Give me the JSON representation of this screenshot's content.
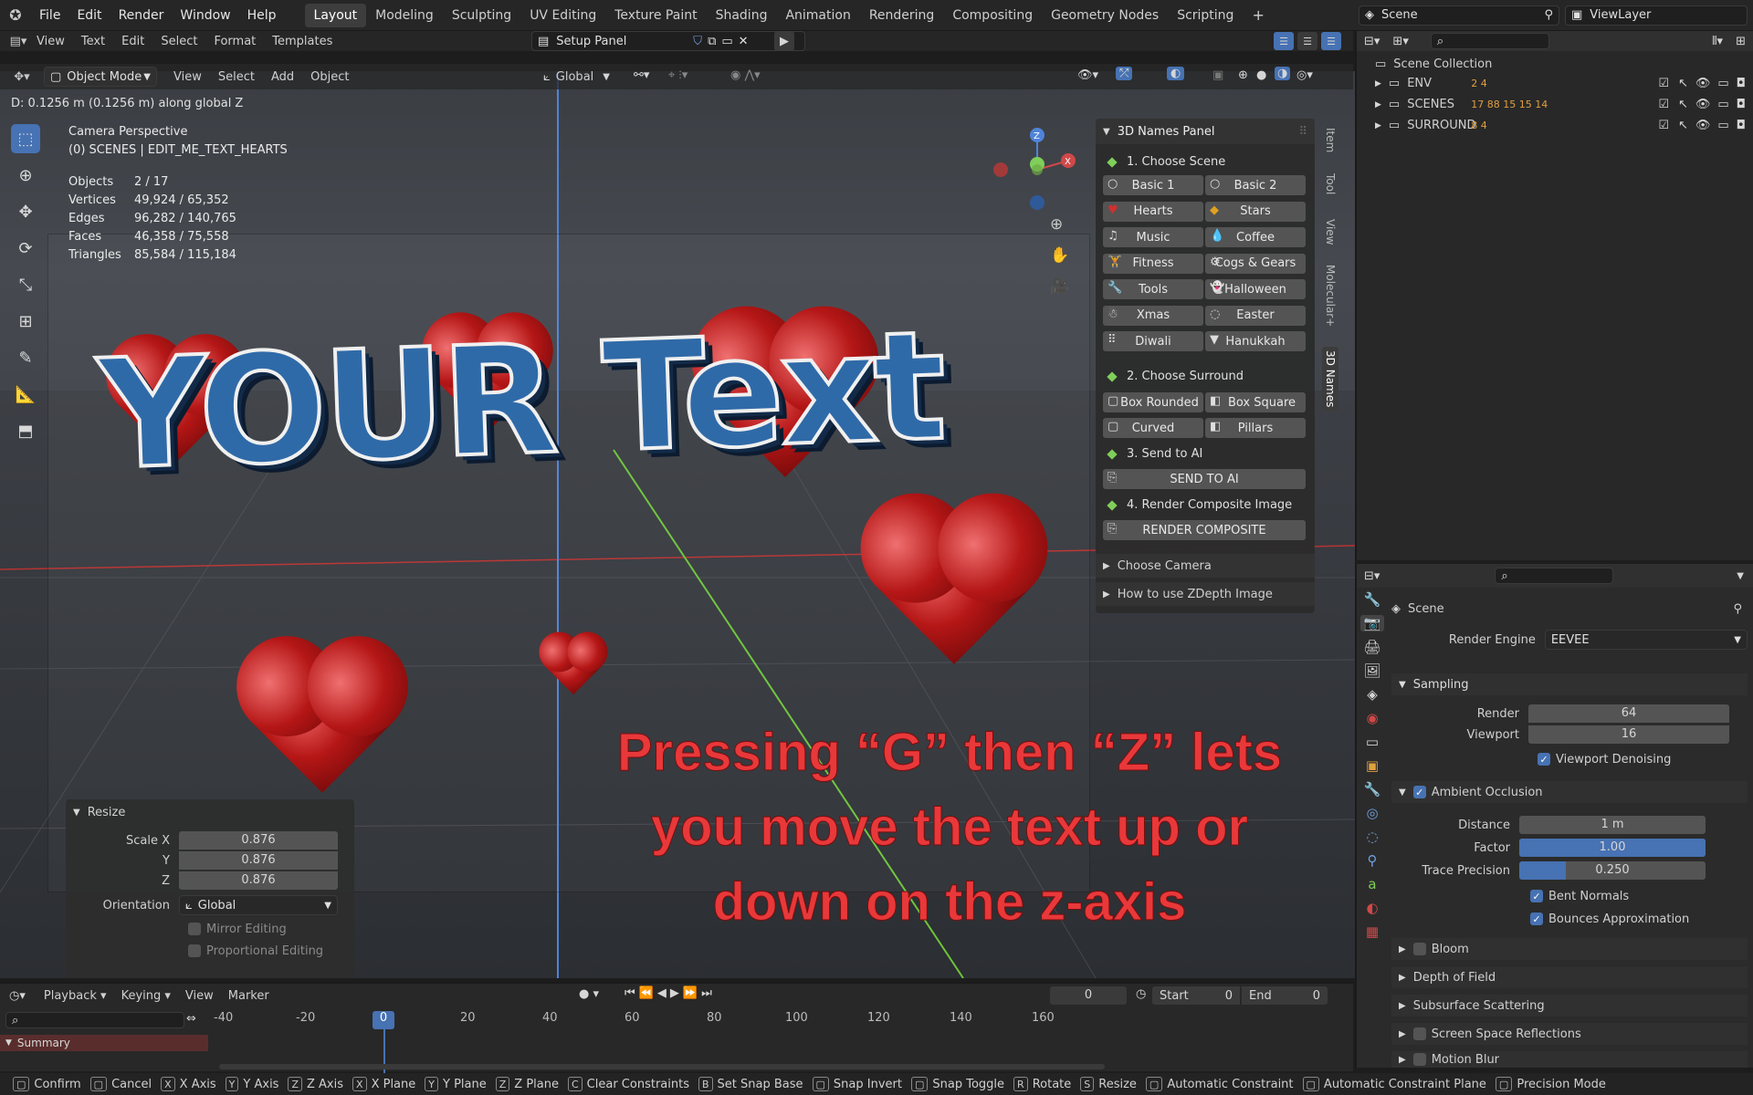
{
  "menu": {
    "items": [
      "File",
      "Edit",
      "Render",
      "Window",
      "Help"
    ]
  },
  "workspaces": [
    "Layout",
    "Modeling",
    "Sculpting",
    "UV Editing",
    "Texture Paint",
    "Shading",
    "Animation",
    "Rendering",
    "Compositing",
    "Geometry Nodes",
    "Scripting"
  ],
  "scene_selector": {
    "value": "Scene"
  },
  "viewlayer_selector": {
    "value": "ViewLayer"
  },
  "text_editor_header": {
    "menus": [
      "View",
      "Text",
      "Edit",
      "Select",
      "Format",
      "Templates"
    ],
    "file_name": "Setup Panel"
  },
  "viewport_header": {
    "mode": "Object Mode",
    "menus": [
      "View",
      "Select",
      "Add",
      "Object"
    ],
    "transform_orientation": "Global"
  },
  "header_message": "D: 0.1256 m (0.1256 m) along global Z",
  "viewport_info": {
    "title": "Camera Perspective",
    "subtitle": "(0) SCENES | EDIT_ME_TEXT_HEARTS",
    "stats": [
      {
        "label": "Objects",
        "value": "2 / 17"
      },
      {
        "label": "Vertices",
        "value": "49,924 / 65,352"
      },
      {
        "label": "Edges",
        "value": "96,282 / 140,765"
      },
      {
        "label": "Faces",
        "value": "46,358 / 75,558"
      },
      {
        "label": "Triangles",
        "value": "85,584 / 115,184"
      }
    ]
  },
  "scene_text": "YOUR Text",
  "annotation": {
    "line1": "Pressing “G” then “Z” lets",
    "line2": "you move the text up or",
    "line3": "down on the z-axis"
  },
  "names_panel": {
    "title": "3D Names Panel",
    "step1": "1. Choose Scene",
    "scenes": [
      "Basic 1",
      "Basic 2",
      "Hearts",
      "Stars",
      "Music",
      "Coffee",
      "Fitness",
      "Cogs & Gears",
      "Tools",
      "Halloween",
      "Xmas",
      "Easter",
      "Diwali",
      "Hanukkah"
    ],
    "step2": "2. Choose Surround",
    "surrounds": [
      "Box Rounded",
      "Box Square",
      "Curved",
      "Pillars"
    ],
    "step3": "3. Send to AI",
    "send_button": "SEND TO AI",
    "step4": "4. Render Composite Image",
    "render_button": "RENDER COMPOSITE",
    "choose_camera": "Choose Camera",
    "zdepth": "How to use ZDepth Image"
  },
  "side_tabs": [
    "Item",
    "Tool",
    "View",
    "Molecular+",
    "3D Names"
  ],
  "resize_panel": {
    "title": "Resize",
    "scale_x_label": "Scale X",
    "scale_x": "0.876",
    "y_label": "Y",
    "y": "0.876",
    "z_label": "Z",
    "z": "0.876",
    "orientation_label": "Orientation",
    "orientation": "Global",
    "mirror": "Mirror Editing",
    "proportional": "Proportional Editing"
  },
  "outliner": {
    "root": "Scene Collection",
    "items": [
      {
        "name": "ENV",
        "counts": "2  4"
      },
      {
        "name": "SCENES",
        "counts": "17 88 15 15 14"
      },
      {
        "name": "SURROUND",
        "counts": "8  4"
      }
    ]
  },
  "properties": {
    "scene_label": "Scene",
    "render_engine_label": "Render Engine",
    "render_engine": "EEVEE",
    "sampling": "Sampling",
    "render_label": "Render",
    "render_value": "64",
    "viewport_label": "Viewport",
    "viewport_value": "16",
    "viewport_denoising": "Viewport Denoising",
    "ambient_occlusion": "Ambient Occlusion",
    "distance_label": "Distance",
    "distance": "1 m",
    "factor_label": "Factor",
    "factor": "1.00",
    "factor_fraction": 1.0,
    "trace_label": "Trace Precision",
    "trace": "0.250",
    "trace_fraction": 0.25,
    "bent_normals": "Bent Normals",
    "bounces": "Bounces Approximation",
    "collapsed": [
      "Bloom",
      "Depth of Field",
      "Subsurface Scattering",
      "Screen Space Reflections",
      "Motion Blur"
    ]
  },
  "timeline": {
    "menus": [
      "Playback",
      "Keying",
      "View",
      "Marker"
    ],
    "current_frame": "0",
    "start_label": "Start",
    "start": "0",
    "end_label": "End",
    "end": "0",
    "ruler": [
      "-40",
      "-20",
      "0",
      "20",
      "40",
      "60",
      "80",
      "100",
      "120",
      "140",
      "160"
    ],
    "summary": "Summary"
  },
  "status_bar": [
    {
      "key": "",
      "label": "Confirm"
    },
    {
      "key": "",
      "label": "Cancel"
    },
    {
      "key": "X",
      "label": "X Axis"
    },
    {
      "key": "Y",
      "label": "Y Axis"
    },
    {
      "key": "Z",
      "label": "Z Axis"
    },
    {
      "key": "X",
      "label": "X Plane"
    },
    {
      "key": "Y",
      "label": "Y Plane"
    },
    {
      "key": "Z",
      "label": "Z Plane"
    },
    {
      "key": "C",
      "label": "Clear Constraints"
    },
    {
      "key": "B",
      "label": "Set Snap Base"
    },
    {
      "key": "",
      "label": "Snap Invert"
    },
    {
      "key": "",
      "label": "Snap Toggle"
    },
    {
      "key": "R",
      "label": "Rotate"
    },
    {
      "key": "S",
      "label": "Resize"
    },
    {
      "key": "",
      "label": "Automatic Constraint"
    },
    {
      "key": "",
      "label": "Automatic Constraint Plane"
    },
    {
      "key": "",
      "label": "Precision Mode"
    }
  ],
  "colors": {
    "accent": "#4772b3",
    "heart": "#b51616",
    "annotation": "#e8383a",
    "text_blue": "#2b5f9a"
  }
}
